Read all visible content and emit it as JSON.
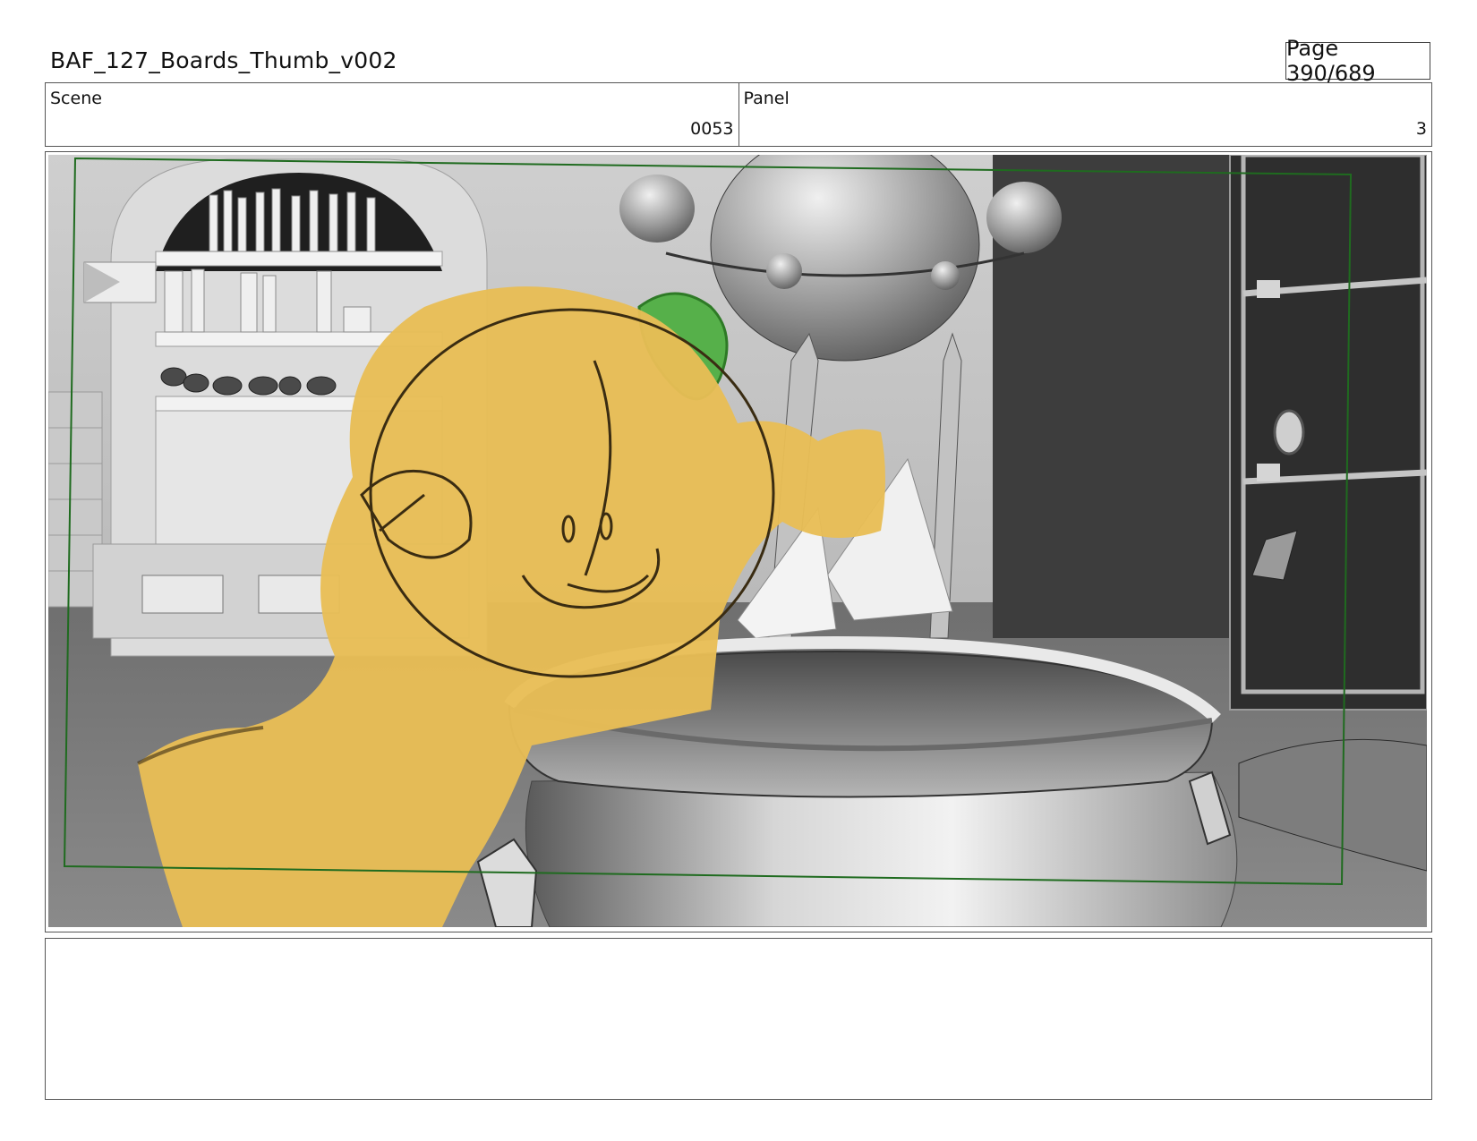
{
  "header": {
    "title": "BAF_127_Boards_Thumb_v002",
    "page": "Page 390/689"
  },
  "scene": {
    "label": "Scene",
    "value": "0053"
  },
  "panel": {
    "label": "Panel",
    "value": "3"
  },
  "notes": {
    "text": ""
  },
  "colors": {
    "character_fill": "#e8bd55",
    "character_leaf": "#56b04a",
    "safe_frame": "#1f6b1f",
    "background_gray": "#b8b8b8",
    "door_dark": "#3a3a3a"
  }
}
